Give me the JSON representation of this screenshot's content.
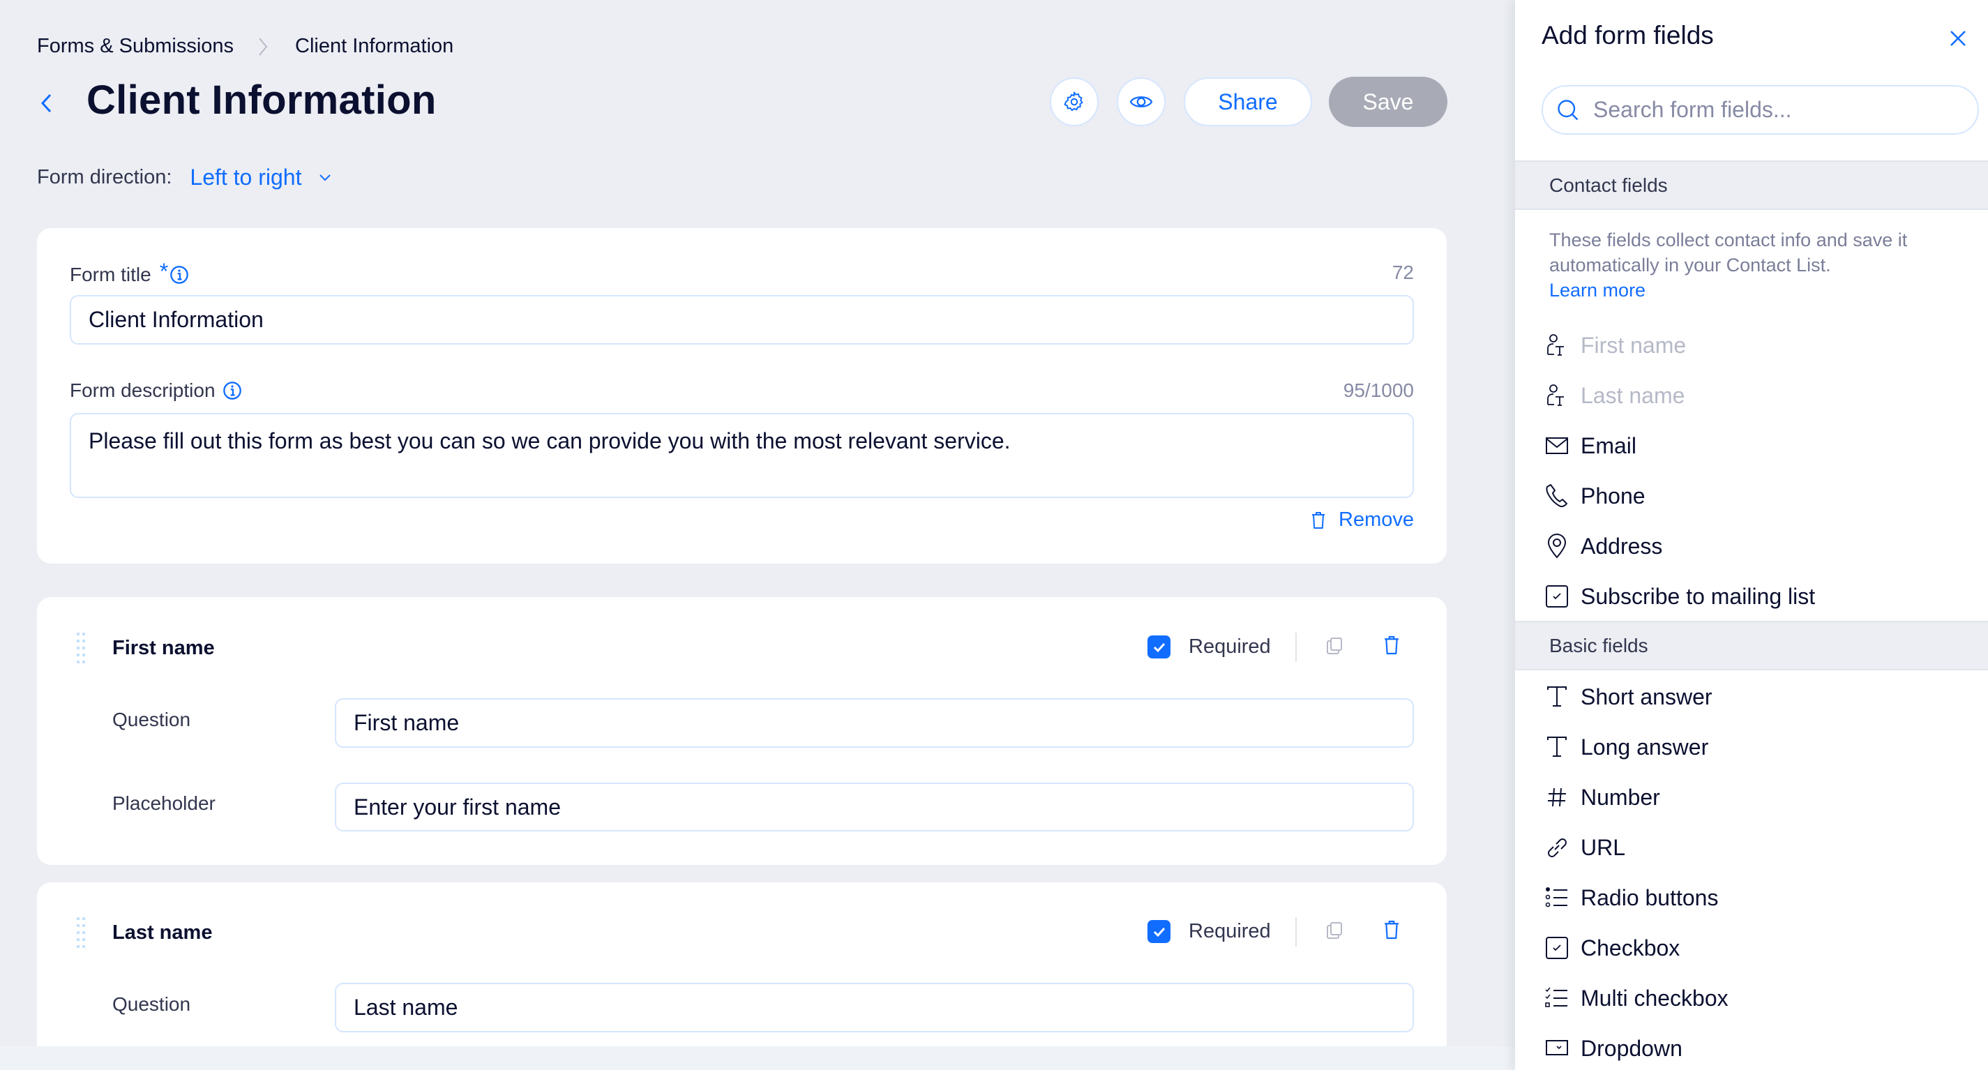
{
  "breadcrumb": {
    "parent": "Forms & Submissions",
    "current": "Client Information"
  },
  "header": {
    "title": "Client Information",
    "settings_icon": "gear-icon",
    "preview_icon": "eye-icon",
    "share_label": "Share",
    "save_label": "Save"
  },
  "direction": {
    "label": "Form direction:",
    "value": "Left to right"
  },
  "form_info": {
    "title_label": "Form title",
    "title_required_mark": "*",
    "title_counter": "72",
    "title_value": "Client Information",
    "description_label": "Form description",
    "description_counter": "95/1000",
    "description_value": "Please fill out this form as best you can so we can provide you with the most relevant service.",
    "remove_label": "Remove"
  },
  "fields": [
    {
      "title": "First name",
      "required_label": "Required",
      "required": true,
      "question_label": "Question",
      "question_value": "First name",
      "placeholder_label": "Placeholder",
      "placeholder_value": "Enter your first name"
    },
    {
      "title": "Last name",
      "required_label": "Required",
      "required": true,
      "question_label": "Question",
      "question_value": "Last name"
    }
  ],
  "panel": {
    "title": "Add form fields",
    "search_placeholder": "Search form fields...",
    "contact_section": {
      "title": "Contact fields",
      "description": "These fields collect contact info and save it automatically in your Contact List.",
      "learn_more": "Learn more",
      "items": [
        {
          "label": "First name",
          "icon": "person-text-icon",
          "disabled": true
        },
        {
          "label": "Last name",
          "icon": "person-text-icon",
          "disabled": true
        },
        {
          "label": "Email",
          "icon": "envelope-icon",
          "disabled": false
        },
        {
          "label": "Phone",
          "icon": "phone-icon",
          "disabled": false
        },
        {
          "label": "Address",
          "icon": "location-pin-icon",
          "disabled": false
        },
        {
          "label": "Subscribe to mailing list",
          "icon": "checkbox-icon",
          "disabled": false
        }
      ]
    },
    "basic_section": {
      "title": "Basic fields",
      "items": [
        {
          "label": "Short answer",
          "icon": "text-t-icon"
        },
        {
          "label": "Long answer",
          "icon": "text-t-icon"
        },
        {
          "label": "Number",
          "icon": "hash-icon"
        },
        {
          "label": "URL",
          "icon": "link-icon"
        },
        {
          "label": "Radio buttons",
          "icon": "radio-list-icon"
        },
        {
          "label": "Checkbox",
          "icon": "checkbox-icon"
        },
        {
          "label": "Multi checkbox",
          "icon": "checklist-icon"
        },
        {
          "label": "Dropdown",
          "icon": "dropdown-icon"
        }
      ]
    }
  },
  "colors": {
    "accent": "#116dff",
    "background": "#eceef3",
    "text": "#0b1030",
    "save_disabled": "#a8abb6"
  }
}
